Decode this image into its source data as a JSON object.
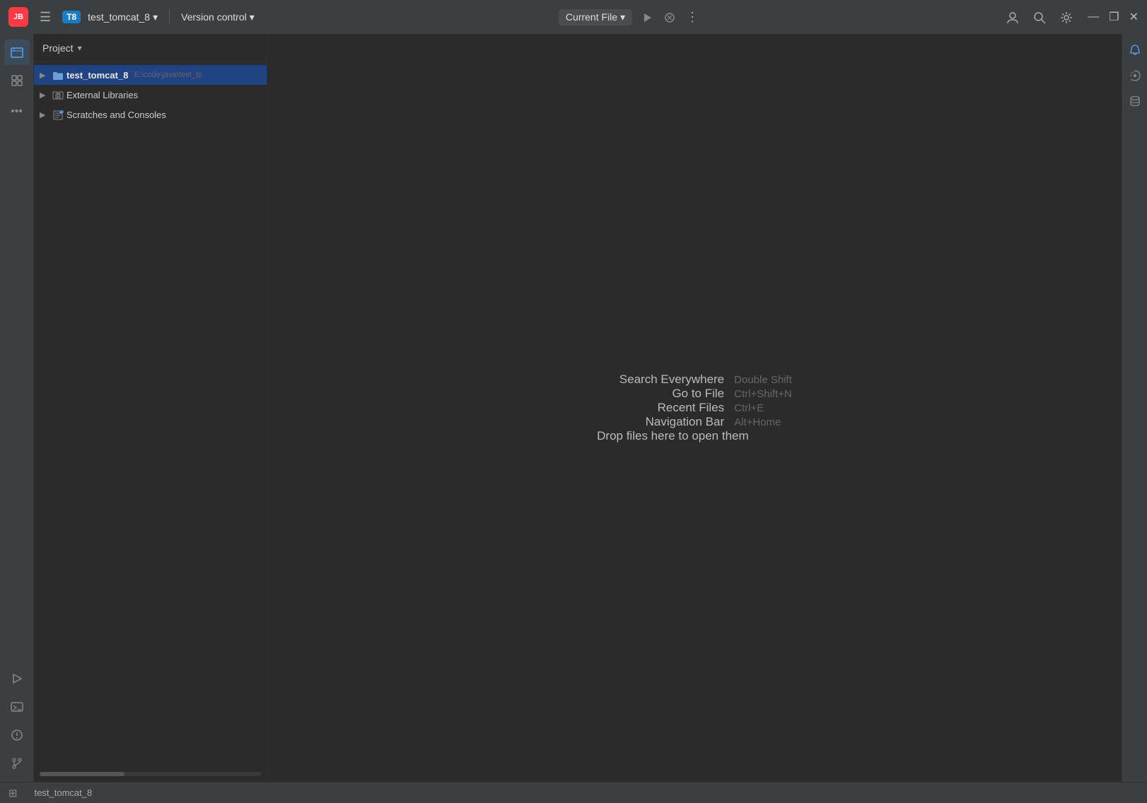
{
  "titlebar": {
    "logo_text": "JB",
    "project_badge": "T8",
    "project_name": "test_tomcat_8",
    "project_dropdown_icon": "▾",
    "version_control_label": "Version control",
    "version_control_dropdown": "▾",
    "current_file_label": "Current File",
    "current_file_dropdown": "▾",
    "window_minimize": "—",
    "window_restore": "❐",
    "window_close": "✕"
  },
  "sidebar": {
    "title": "Project",
    "dropdown_icon": "▾",
    "items": [
      {
        "label": "test_tomcat_8",
        "path": "E:\\code\\java\\test_to",
        "icon": "📁",
        "level": 0,
        "selected": true,
        "expanded": false
      },
      {
        "label": "External Libraries",
        "path": "",
        "icon": "📚",
        "level": 0,
        "selected": false,
        "expanded": false
      },
      {
        "label": "Scratches and Consoles",
        "path": "",
        "icon": "📋",
        "level": 0,
        "selected": false,
        "expanded": false
      }
    ]
  },
  "content": {
    "hints": [
      {
        "action": "Search Everywhere",
        "shortcut": "Double Shift"
      },
      {
        "action": "Go to File",
        "shortcut": "Ctrl+Shift+N"
      },
      {
        "action": "Recent Files",
        "shortcut": "Ctrl+E"
      },
      {
        "action": "Navigation Bar",
        "shortcut": "Alt+Home"
      },
      {
        "action": "Drop files here to open them",
        "shortcut": ""
      }
    ]
  },
  "status_bar": {
    "project_name": "test_tomcat_8"
  }
}
